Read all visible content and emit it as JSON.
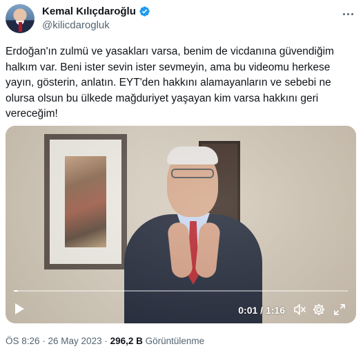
{
  "author": {
    "display_name": "Kemal Kılıçdaroğlu",
    "handle": "@kilicdarogluk",
    "verified_color": "#1d9bf0"
  },
  "more_icon": "more-horizontal-icon",
  "tweet": {
    "text": "Erdoğan'ın zulmü ve yasakları varsa, benim de vicdanına güvendiğim halkım var. Beni ister sevin ister sevmeyin, ama bu videomu herkese yayın, gösterin, anlatın. EYT'den hakkını alamayanların ve sebebi ne olursa olsun bu ülkede mağduriyet yaşayan kim varsa hakkını geri vereceğim!"
  },
  "video": {
    "current_time": "0:01",
    "separator": " / ",
    "duration": "1:16",
    "progress": 0.013,
    "controls": [
      "play-icon",
      "mute-icon",
      "settings-icon",
      "fullscreen-icon"
    ]
  },
  "meta": {
    "time": "ÖS 8:26",
    "dot1": " · ",
    "date": "26 May 2023",
    "dot2": " · ",
    "views": "296,2 B",
    "views_label": " Görüntülenme"
  }
}
